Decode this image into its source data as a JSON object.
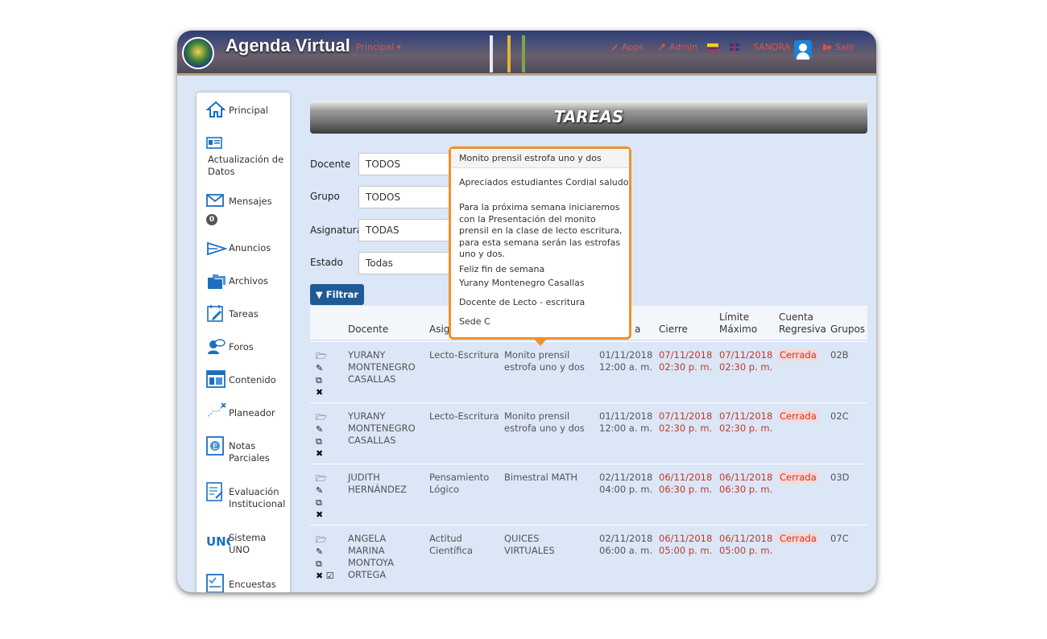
{
  "header": {
    "title": "Agenda Virtual",
    "nav_principal": "Principal",
    "apps": "Apps",
    "admin": "Admin",
    "user": "SANDRA",
    "salir": "Salir"
  },
  "sidebar": {
    "items": [
      {
        "label": "Principal",
        "icon": "home-icon"
      },
      {
        "label": "Actualización de Datos",
        "icon": "id-card-icon"
      },
      {
        "label": "Mensajes",
        "icon": "envelope-icon",
        "badge": "0"
      },
      {
        "label": "Anuncios",
        "icon": "megaphone-icon"
      },
      {
        "label": "Archivos",
        "icon": "folder-icon"
      },
      {
        "label": "Tareas",
        "icon": "calendar-edit-icon"
      },
      {
        "label": "Foros",
        "icon": "forum-icon"
      },
      {
        "label": "Contenido",
        "icon": "layout-icon"
      },
      {
        "label": "Planeador",
        "icon": "planner-icon"
      },
      {
        "label": "Notas Parciales",
        "icon": "grades-icon"
      },
      {
        "label": "Evaluación Institucional",
        "icon": "evaluation-icon"
      },
      {
        "label": "Sistema UNO",
        "icon": "uno-logo-icon"
      },
      {
        "label": "Encuestas",
        "icon": "survey-icon"
      }
    ]
  },
  "main": {
    "title": "TAREAS",
    "filters": [
      {
        "label": "Docente",
        "value": "TODOS"
      },
      {
        "label": "Grupo",
        "value": "TODOS"
      },
      {
        "label": "Asignatura",
        "value": "TODAS"
      },
      {
        "label": "Estado",
        "value": "Todas"
      }
    ],
    "filter_button": "Filtrar",
    "columns": {
      "docente": "Docente",
      "asignatura": "Asig",
      "fecha": "a",
      "cierre": "Cierre",
      "limite": "Límite Máximo",
      "cuenta": "Cuenta Regresiva",
      "grupos": "Grupos"
    },
    "rows": [
      {
        "docente": "YURANY MONTENEGRO CASALLAS",
        "asignatura": "Lecto-Escritura",
        "tarea": "Monito prensil estrofa uno y dos",
        "inicio": "01/11/2018 12:00 a. m.",
        "cierre": "07/11/2018 02:30 p. m.",
        "limite": "07/11/2018 02:30 p. m.",
        "estado": "Cerrada",
        "grupo": "02B"
      },
      {
        "docente": "YURANY MONTENEGRO CASALLAS",
        "asignatura": "Lecto-Escritura",
        "tarea": "Monito prensil estrofa uno y dos",
        "inicio": "01/11/2018 12:00 a. m.",
        "cierre": "07/11/2018 02:30 p. m.",
        "limite": "07/11/2018 02:30 p. m.",
        "estado": "Cerrada",
        "grupo": "02C"
      },
      {
        "docente": "JUDITH HERNÁNDEZ",
        "asignatura": "Pensamiento Lógico",
        "tarea": "Bimestral MATH",
        "inicio": "02/11/2018 04:00 p. m.",
        "cierre": "06/11/2018 06:30 p. m.",
        "limite": "06/11/2018 06:30 p. m.",
        "estado": "Cerrada",
        "grupo": "03D"
      },
      {
        "docente": "ANGELA MARINA MONTOYA ORTEGA",
        "asignatura": "Actitud Científica",
        "tarea": "QUICES VIRTUALES",
        "inicio": "02/11/2018 06:00 a. m.",
        "cierre": "06/11/2018 05:00 p. m.",
        "limite": "06/11/2018 05:00 p. m.",
        "estado": "Cerrada",
        "grupo": "07C"
      }
    ]
  },
  "tooltip": {
    "title": "Monito prensil estrofa uno y dos",
    "line1": "Apreciados estudiantes Cordial saludo",
    "para1": "Para la próxima semana iniciaremos con la Presentación del monito prensil en la clase de lecto escritura, para esta semana serán las estrofas uno y dos.",
    "line2": "Feliz fin de semana",
    "line3": "Yurany Montenegro Casallas",
    "line4": "Docente de Lecto - escritura",
    "line5": "Sede C"
  },
  "colors": {
    "accent": "#1e5a96",
    "tooltip_border": "#f0912a",
    "status_red": "#c0392b"
  }
}
